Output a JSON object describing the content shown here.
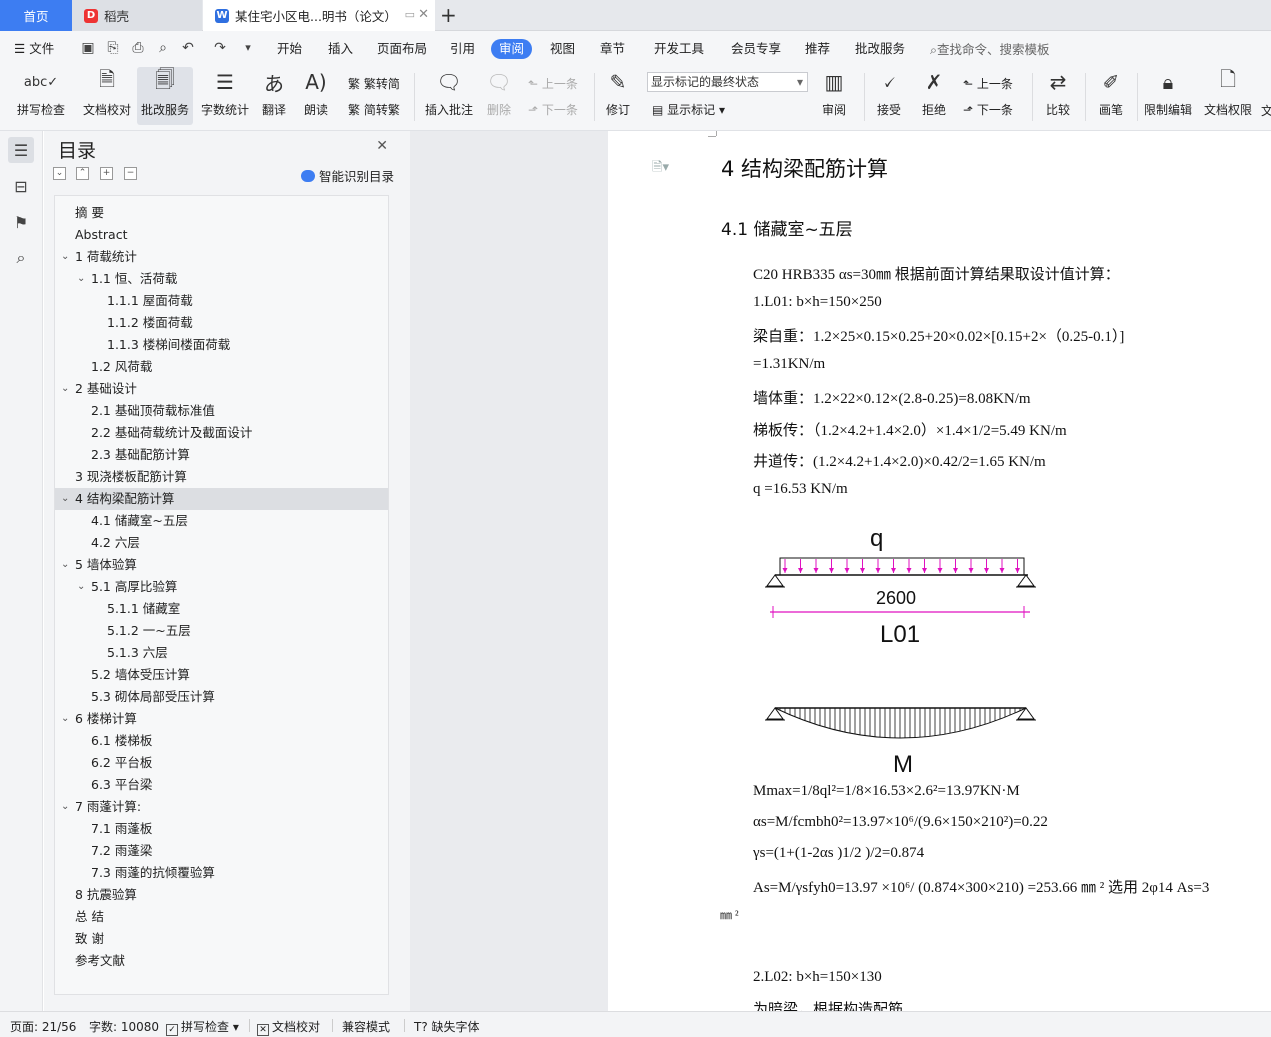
{
  "tabs": {
    "home": "首页",
    "docer": "稻壳",
    "doc": "某住宅小区电...明书（论文）"
  },
  "menubar": {
    "file": "文件",
    "items": [
      "开始",
      "插入",
      "页面布局",
      "引用",
      "审阅",
      "视图",
      "章节",
      "开发工具",
      "会员专享",
      "推荐",
      "批改服务"
    ],
    "active": "审阅",
    "search": "查找命令、搜索模板"
  },
  "ribbon": {
    "spell": "拼写检查",
    "proof": "文档校对",
    "correct": "批改服务",
    "wordcount": "字数统计",
    "translate": "翻译",
    "read": "朗读",
    "trad": "繁转简",
    "simp": "简转繁",
    "insert_comment": "插入批注",
    "delete": "删除",
    "prev_comment": "上一条",
    "next_comment": "下一条",
    "revise": "修订",
    "markup_state": "显示标记的最终状态",
    "show_markup": "显示标记",
    "review": "审阅",
    "accept": "接受",
    "reject": "拒绝",
    "prev_change": "上一条",
    "next_change": "下一条",
    "compare": "比较",
    "pen": "画笔",
    "restrict": "限制编辑",
    "permission": "文档权限",
    "cut": "文"
  },
  "toc": {
    "title": "目录",
    "smart": "智能识别目录",
    "items": [
      {
        "text": "摘    要",
        "level": 0,
        "arrow": false
      },
      {
        "text": "Abstract",
        "level": 0,
        "arrow": false
      },
      {
        "text": "1  荷载统计",
        "level": 0,
        "arrow": true
      },
      {
        "text": "1.1  恒、活荷载",
        "level": 1,
        "arrow": true
      },
      {
        "text": "1.1.1 屋面荷载",
        "level": 2,
        "arrow": false
      },
      {
        "text": "1.1.2  楼面荷载",
        "level": 2,
        "arrow": false
      },
      {
        "text": "1.1.3  楼梯间楼面荷载",
        "level": 2,
        "arrow": false
      },
      {
        "text": "1.2  风荷载",
        "level": 1,
        "arrow": false
      },
      {
        "text": "2  基础设计",
        "level": 0,
        "arrow": true
      },
      {
        "text": "2.1  基础顶荷载标准值",
        "level": 1,
        "arrow": false
      },
      {
        "text": "2.2  基础荷载统计及截面设计",
        "level": 1,
        "arrow": false
      },
      {
        "text": "2.3  基础配筋计算",
        "level": 1,
        "arrow": false
      },
      {
        "text": "3  现浇楼板配筋计算",
        "level": 0,
        "arrow": false
      },
      {
        "text": "4  结构梁配筋计算",
        "level": 0,
        "arrow": true
      },
      {
        "text": "4.1  储藏室~五层",
        "level": 1,
        "arrow": false
      },
      {
        "text": "4.2  六层",
        "level": 1,
        "arrow": false
      },
      {
        "text": "5  墙体验算",
        "level": 0,
        "arrow": true
      },
      {
        "text": "5.1  高厚比验算",
        "level": 1,
        "arrow": true
      },
      {
        "text": "5.1.1 储藏室",
        "level": 2,
        "arrow": false
      },
      {
        "text": "5.1.2  一~五层",
        "level": 2,
        "arrow": false
      },
      {
        "text": "5.1.3  六层",
        "level": 2,
        "arrow": false
      },
      {
        "text": "5.2  墙体受压计算",
        "level": 1,
        "arrow": false
      },
      {
        "text": "5.3  砌体局部受压计算",
        "level": 1,
        "arrow": false
      },
      {
        "text": "6  楼梯计算",
        "level": 0,
        "arrow": true
      },
      {
        "text": "6.1  楼梯板",
        "level": 1,
        "arrow": false
      },
      {
        "text": "6.2  平台板",
        "level": 1,
        "arrow": false
      },
      {
        "text": "6.3  平台梁",
        "level": 1,
        "arrow": false
      },
      {
        "text": "7  雨蓬计算:",
        "level": 0,
        "arrow": true
      },
      {
        "text": "7.1  雨蓬板",
        "level": 1,
        "arrow": false
      },
      {
        "text": "7.2  雨蓬梁",
        "level": 1,
        "arrow": false
      },
      {
        "text": "7.3  雨蓬的抗倾覆验算",
        "level": 1,
        "arrow": false
      },
      {
        "text": "8  抗震验算",
        "level": 0,
        "arrow": false
      },
      {
        "text": "总    结",
        "level": 0,
        "arrow": false
      },
      {
        "text": "致    谢",
        "level": 0,
        "arrow": false
      },
      {
        "text": "参考文献",
        "level": 0,
        "arrow": false
      }
    ],
    "selected_index": 13
  },
  "doc": {
    "h1": "4  结构梁配筋计算",
    "h2": "4.1  储藏室~五层",
    "lines": [
      "C20    HRB335       αs=30㎜    根据前面计算结果取设计值计算：",
      "1.L01:    b×h=150×250",
      "梁自重：1.2×25×0.15×0.25+20×0.02×[0.15+2×（0.25-0.1）]",
      "=1.31KN/m",
      "墙体重：1.2×22×0.12×(2.8-0.25)=8.08KN/m",
      "梯板传：（1.2×4.2+1.4×2.0）×1.4×1/2=5.49 KN/m",
      "井道传：(1.2×4.2+1.4×2.0)×0.42/2=1.65 KN/m",
      "q =16.53 KN/m"
    ],
    "fig_q": "q",
    "fig_span": "2600",
    "fig_name": "L01",
    "fig_m": "M",
    "calc": [
      "Mmax=1/8ql²=1/8×16.53×2.6²=13.97KN·M",
      "αs=M/fcmbh0²=13.97×10⁶/(9.6×150×210²)=0.22",
      "γs=(1+(1-2αs )1/2 )/2=0.874",
      "As=M/γsfyh0=13.97 ×10⁶/ (0.874×300×210) =253.66 ㎜ ²    选用 2φ14        As=3",
      "㎜ ²",
      "2.L02:    b×h=150×130",
      "为暗梁，根据构造配筋"
    ]
  },
  "status": {
    "page": "页面: 21/56",
    "words": "字数: 10080",
    "spell": "拼写检查",
    "proof": "文档校对",
    "compat": "兼容模式",
    "font": "缺失字体"
  },
  "colors": {
    "accent": "#3d7df2",
    "load": "#e010c0"
  }
}
